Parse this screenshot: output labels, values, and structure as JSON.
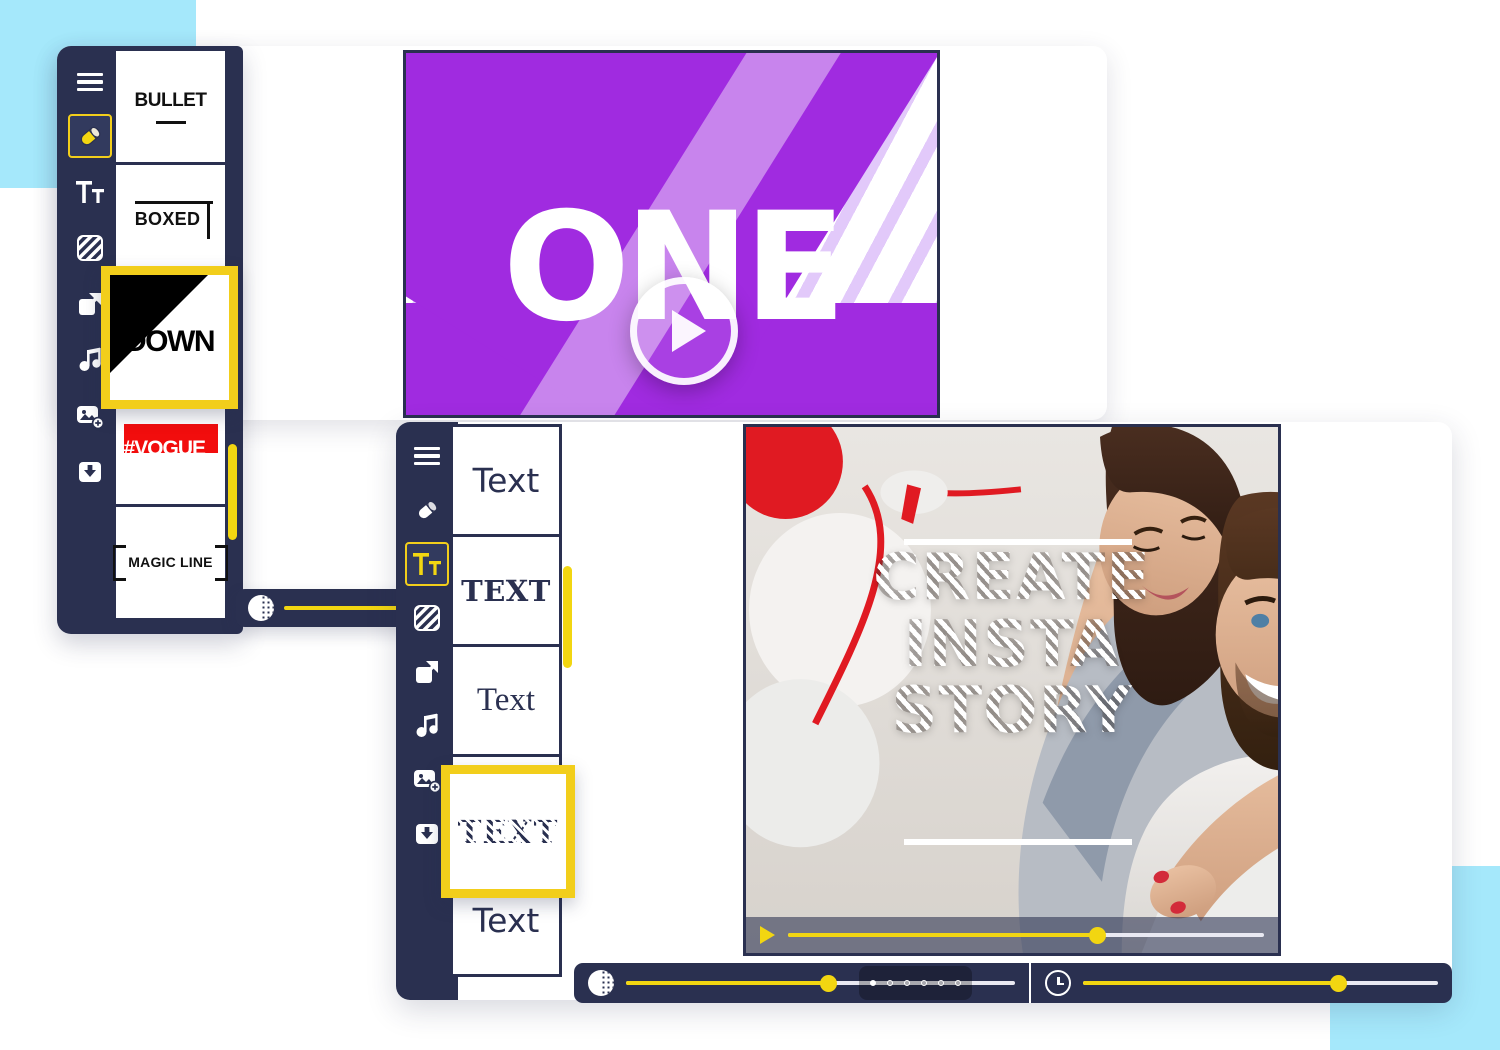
{
  "decor": {
    "cyan": "#A5E8FB",
    "dark": "#2A3050",
    "yellow": "#F2D611",
    "purple": "#A02BE0",
    "red": "#F20D0D"
  },
  "window_one": {
    "sidebar": [
      {
        "name": "menu-icon",
        "label": "Menu",
        "selected": false
      },
      {
        "name": "eraser-icon",
        "label": "Eraser",
        "selected": true
      },
      {
        "name": "text-tool-icon",
        "label": "Text",
        "selected": false
      },
      {
        "name": "pattern-icon",
        "label": "Pattern",
        "selected": false
      },
      {
        "name": "resize-icon",
        "label": "Resize",
        "selected": false
      },
      {
        "name": "music-icon",
        "label": "Music",
        "selected": false
      },
      {
        "name": "add-image-icon",
        "label": "Add image",
        "selected": false
      },
      {
        "name": "download-icon",
        "label": "Download",
        "selected": false
      }
    ],
    "cards": [
      {
        "id": "bullet",
        "label": "BULLET"
      },
      {
        "id": "boxed",
        "label": "BOXED"
      },
      {
        "id": "vogue",
        "label": "#VOGUE"
      },
      {
        "id": "magic-line",
        "label": "MAGIC LINE"
      }
    ],
    "selected_card": {
      "id": "down",
      "label": "DOWN"
    },
    "slider": {
      "value": 100
    }
  },
  "window_two": {
    "sidebar": [
      {
        "name": "menu-icon",
        "label": "Menu",
        "selected": false
      },
      {
        "name": "eraser-icon",
        "label": "Eraser",
        "selected": false
      },
      {
        "name": "text-tool-icon",
        "label": "Text",
        "selected": true
      },
      {
        "name": "pattern-icon",
        "label": "Pattern",
        "selected": false
      },
      {
        "name": "resize-icon",
        "label": "Resize",
        "selected": false
      },
      {
        "name": "music-icon",
        "label": "Music",
        "selected": false
      },
      {
        "name": "add-image-icon",
        "label": "Add image",
        "selected": false
      },
      {
        "name": "download-icon",
        "label": "Download",
        "selected": false
      }
    ],
    "cards": [
      {
        "id": "text-sans",
        "label": "Text"
      },
      {
        "id": "text-slab",
        "label": "TEXT"
      },
      {
        "id": "text-serif",
        "label": "Text"
      },
      {
        "id": "text-hand",
        "label": "Text"
      }
    ],
    "selected_card": {
      "id": "text-striped",
      "label": "TEXT"
    },
    "opacity_slider": {
      "value": 52
    },
    "duration_slider": {
      "value": 72
    },
    "dots": [
      true,
      false,
      false,
      false,
      false,
      false
    ]
  },
  "preview_one": {
    "title": "ONE",
    "play_label": "Play"
  },
  "story_preview": {
    "lines": [
      "CREATE",
      "INSTA",
      "STORY"
    ],
    "progress": 65,
    "play_label": "Play"
  }
}
